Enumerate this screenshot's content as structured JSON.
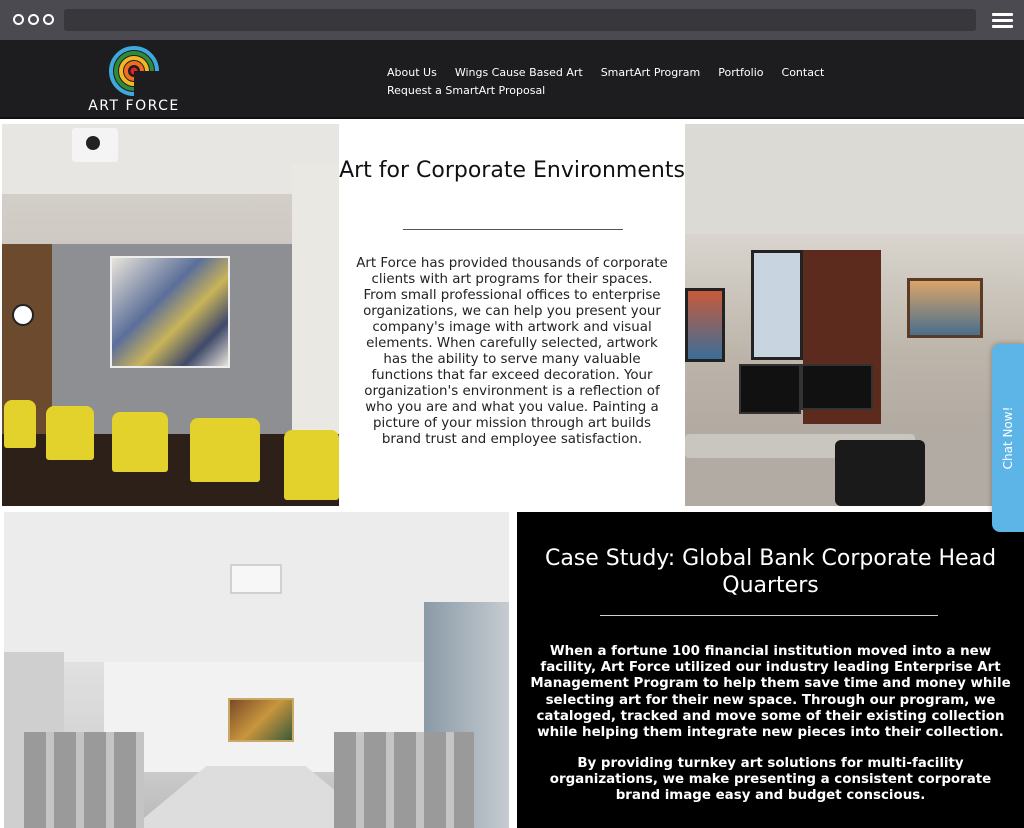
{
  "browser": {
    "menu_icon": "hamburger-icon",
    "window_dots_icon": "window-dots-icon"
  },
  "header": {
    "logo_text": "ART FORCE",
    "logo_icon": "art-force-rainbow-logo",
    "nav": [
      {
        "label": "About Us"
      },
      {
        "label": "Wings Cause Based Art"
      },
      {
        "label": "SmartArt Program"
      },
      {
        "label": "Portfolio"
      },
      {
        "label": "Contact"
      },
      {
        "label": "Request a SmartArt Proposal"
      }
    ]
  },
  "section1": {
    "title": "Art for Corporate Environments",
    "body": "Art Force has provided thousands of corporate clients with art programs for their spaces. From small professional offices to enterprise organizations, we can help you present your company's image with artwork and visual elements. When carefully selected, artwork has the ability to serve many valuable functions that far exceed decoration. Your organization's environment is a reflection of who you are and what you value. Painting a picture of your mission through art builds brand trust and employee satisfaction."
  },
  "section2": {
    "title": "Case Study: Global Bank Corporate Head Quarters",
    "para1": "When a fortune 100 financial institution moved into a new facility, Art Force utilized our industry leading Enterprise Art Management Program to help them save time and money while selecting art for their new space. Through our program, we cataloged, tracked and move some of their existing collection while helping them integrate new pieces into their collection.",
    "para2": "By providing turnkey art solutions for multi-facility organizations, we make presenting a consistent corporate brand image easy and budget conscious."
  },
  "chat": {
    "label": "Chat Now!"
  },
  "colors": {
    "header_bg": "#1d1c1e",
    "chrome_bg": "#4b4a50",
    "chat_tab": "#5db4e6",
    "case_study_bg": "#000000"
  }
}
